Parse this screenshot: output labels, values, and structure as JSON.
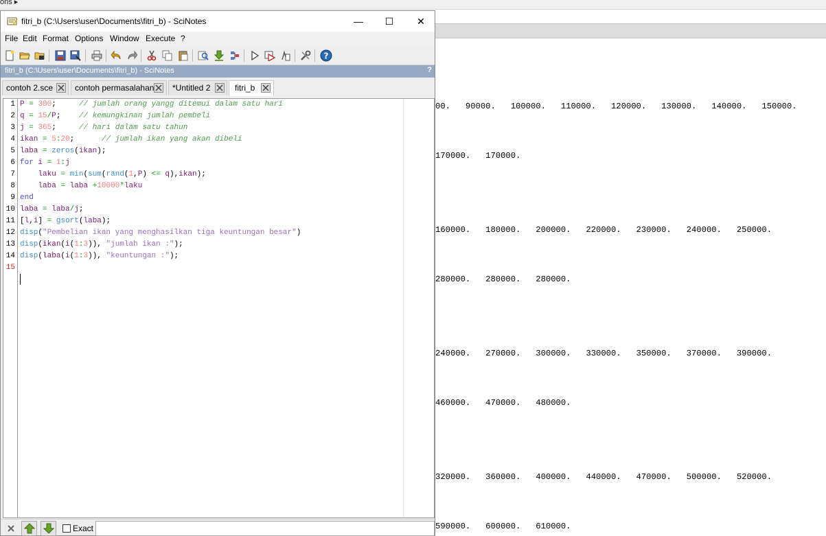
{
  "background_console": {
    "top_fragment": "ons  ▸",
    "lines": [
      "00.   90000.   100000.   110000.   120000.   130000.   140000.   150000.",
      "170000.   170000.",
      "160000.   180000.   200000.   220000.   230000.   240000.   250000.",
      "280000.   280000.   280000.",
      "240000.   270000.   300000.   330000.   350000.   370000.   390000.",
      "460000.   470000.   480000.",
      "320000.   360000.   400000.   440000.   470000.   500000.   520000.",
      "590000.   600000.   610000."
    ]
  },
  "window": {
    "title": "fitri_b (C:\\Users\\user\\Documents\\fitri_b) - SciNotes",
    "minimize": "—",
    "maximize": "☐",
    "close": "✕"
  },
  "menu": {
    "file": "File",
    "edit": "Edit",
    "format": "Format",
    "options": "Options",
    "window": "Window",
    "execute": "Execute",
    "help": "?"
  },
  "doc_title": {
    "text": "fitri_b (C:\\Users\\user\\Documents\\fitri_b) - SciNotes",
    "help": "?"
  },
  "tabs": [
    {
      "label": "contoh 2.sce"
    },
    {
      "label": "contoh permasalahan"
    },
    {
      "label": "*Untitled 2"
    },
    {
      "label": "fitri_b"
    }
  ],
  "line_numbers": [
    "1",
    "2",
    "3",
    "4",
    "5",
    "6",
    "7",
    "8",
    "9",
    "10",
    "11",
    "12",
    "13",
    "14",
    "15"
  ],
  "code_lines": [
    "P = 300;     // jumlah orang yangg ditemui dalam satu hari",
    "q = 15/P;    // kemungkinan jumlah pembeli",
    "j = 365;     // hari dalam satu tahun",
    "ikan = 5:20;      // jumlah ikan yang akan dibeli",
    "laba = zeros(ikan);",
    "for i = 1:j",
    "    laku = min(sum(rand(1,P) <= q),ikan);",
    "    laba = laba +10000*laku",
    "end",
    "laba = laba/j;",
    "[l,i] = gsort(laba);",
    "disp(\"Pembelian ikan yang menghasilkan tiga keuntungan besar\")",
    "disp(ikan(i(1:3)), \"jumlah ikan :\");",
    "disp(laba(i(1:3)), \"keuntungan :\");",
    ""
  ],
  "find_bar": {
    "exact_label": "Exact",
    "exact_checked": false,
    "search_value": ""
  },
  "icons": {
    "app": "scinotes-app-icon",
    "toolbar": [
      "new-file-icon",
      "open-file-icon",
      "open-recent-icon",
      "save-icon",
      "save-as-icon",
      "print-icon",
      "undo-icon",
      "redo-icon",
      "cut-icon",
      "copy-icon",
      "paste-icon",
      "find-replace-icon",
      "load-into-scilab-icon",
      "execute-icon",
      "run-icon",
      "run-until-icon",
      "execute-debug-icon",
      "preferences-icon",
      "help-icon"
    ]
  },
  "colors": {
    "doc_title_bg": "#97aac4",
    "keyword": "#4f4ac9",
    "comment": "#4f9d4f",
    "number": "#ff7b7b",
    "function": "#3b8ed0",
    "string": "#986fc0"
  }
}
